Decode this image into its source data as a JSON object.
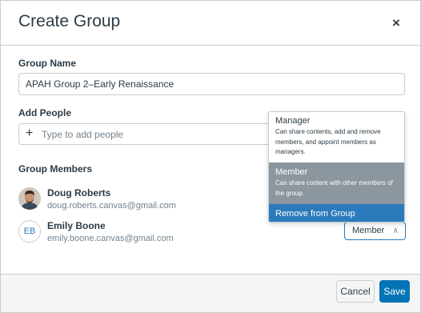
{
  "dialog": {
    "title": "Create Group",
    "close_icon": "close-icon",
    "close_glyph": "×"
  },
  "group_name": {
    "label": "Group Name",
    "value": "APAH Group 2–Early Renaissance"
  },
  "add_people": {
    "label": "Add People",
    "placeholder": "Type to add people",
    "icon": "plus-icon",
    "icon_glyph": "+"
  },
  "members": {
    "label": "Group Members",
    "list": [
      {
        "name": "Doug Roberts",
        "email": "doug.roberts.canvas@gmail.com",
        "avatar": "photo"
      },
      {
        "name": "Emily Boone",
        "email": "emily.boone.canvas@gmail.com",
        "avatar_initials": "EB"
      }
    ]
  },
  "role_select": {
    "value": "Member",
    "icon": "chevron-up-icon",
    "icon_glyph": "∧"
  },
  "role_menu": {
    "options": [
      {
        "title": "Manager",
        "description": "Can share contents, add and remove members, and appoint members as managers."
      },
      {
        "title": "Member",
        "description": "Can share content with other members of the group.",
        "highlighted": true
      },
      {
        "title": "Remove from Group",
        "selected": true
      }
    ]
  },
  "footer": {
    "cancel_label": "Cancel",
    "save_label": "Save"
  },
  "colors": {
    "primary": "#0374b5",
    "text": "#2d3b45",
    "muted": "#73818c",
    "border": "#c7cdd1",
    "highlight": "#8b969e",
    "selected": "#2b7abc"
  }
}
